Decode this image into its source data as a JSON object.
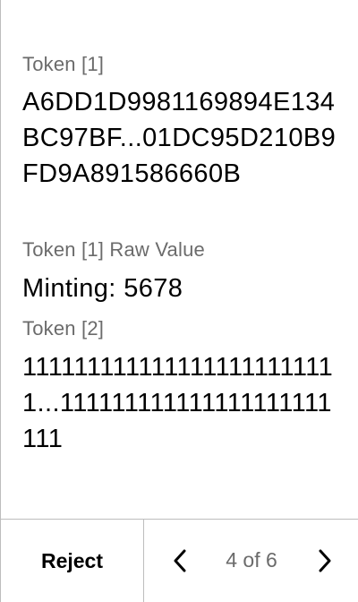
{
  "fields": [
    {
      "label": "Token [1]",
      "value": "A6DD1D9981169894E134BC97BF...01DC95D210B9FD9A891586660B"
    },
    {
      "label": "Token [1] Raw Value",
      "value": "Minting: 5678"
    },
    {
      "label": "Token [2]",
      "value": "1111111111111111111111111...111111111111111111111111"
    }
  ],
  "footer": {
    "reject_label": "Reject",
    "page_indicator": "4 of 6",
    "prev_icon": "chevron-left-icon",
    "next_icon": "chevron-right-icon"
  }
}
